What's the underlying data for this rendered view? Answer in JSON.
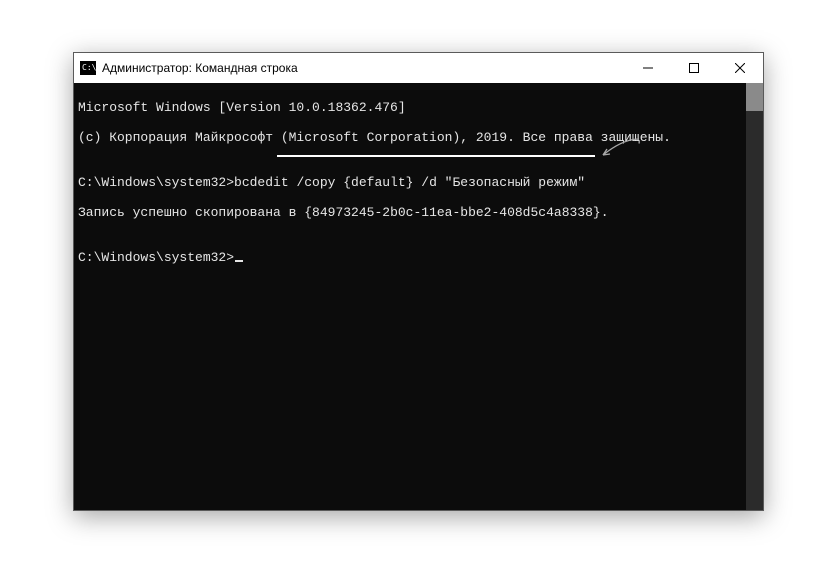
{
  "titlebar": {
    "icon_text": "C:\\",
    "title": "Администратор: Командная строка"
  },
  "terminal": {
    "line1": "Microsoft Windows [Version 10.0.18362.476]",
    "line2": "(c) Корпорация Майкрософт (Microsoft Corporation), 2019. Все права защищены.",
    "blank1": "",
    "prompt1_prefix": "C:\\Windows\\system32>",
    "prompt1_cmd": "bcdedit /copy {default} /d \"Безопасный режим\"",
    "result_prefix": "Запись успешно скопирована в ",
    "result_guid": "{84973245-2b0c-11ea-bbe2-408d5c4a8338}",
    "result_suffix": ".",
    "blank2": "",
    "prompt2": "C:\\Windows\\system32>"
  }
}
